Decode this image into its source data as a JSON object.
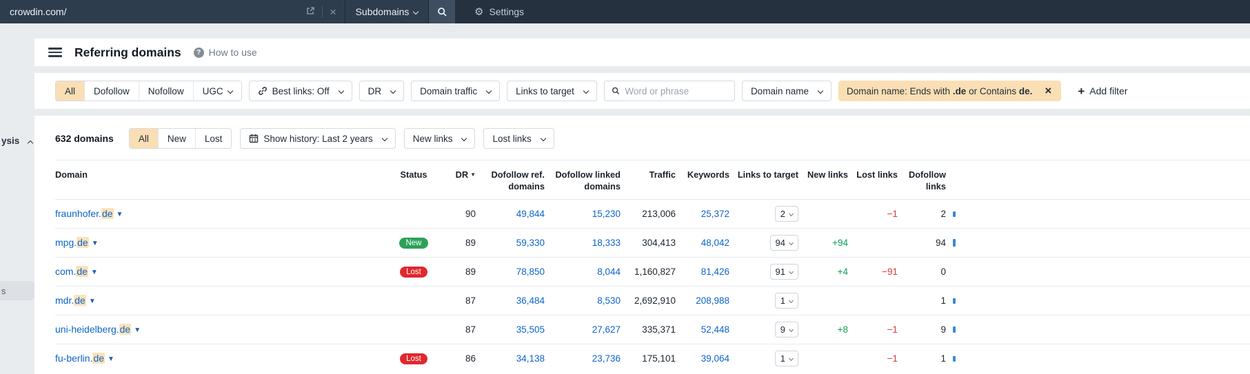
{
  "topbar": {
    "target": "crowdin.com/",
    "mode": "Subdomains",
    "settings": "Settings"
  },
  "header": {
    "title": "Referring domains",
    "help": "How to use"
  },
  "rail": {
    "partial_label": "ysis",
    "partial_letter": "s"
  },
  "filters": {
    "segments": [
      "All",
      "Dofollow",
      "Nofollow",
      "UGC"
    ],
    "selected_segment": "All",
    "best_links": "Best links: Off",
    "dr": "DR",
    "domain_traffic": "Domain traffic",
    "links_to_target": "Links to target",
    "search_placeholder": "Word or phrase",
    "domain_name": "Domain name",
    "active_filter": {
      "t1": "Domain name: Ends with ",
      "b1": ".de",
      "t2": " or Contains ",
      "b2": "de."
    },
    "add_filter": "Add filter"
  },
  "toolbar": {
    "count": "632 domains",
    "segments": [
      "All",
      "New",
      "Lost"
    ],
    "selected_segment": "All",
    "show_history": "Show history: Last 2 years",
    "new_links": "New links",
    "lost_links": "Lost links"
  },
  "table": {
    "columns": {
      "domain": "Domain",
      "status": "Status",
      "dr": "DR",
      "dofollow_ref": "Dofollow ref. domains",
      "dofollow_linked": "Dofollow linked domains",
      "traffic": "Traffic",
      "keywords": "Keywords",
      "links_to_target": "Links to target",
      "new_links": "New links",
      "lost_links": "Lost links",
      "dofollow_links": "Dofollow links"
    },
    "rows": [
      {
        "domain_prefix": "fraunhofer.",
        "match": "de",
        "status": "",
        "dr": "90",
        "dofollow_ref": "49,844",
        "dofollow_linked": "15,230",
        "traffic": "213,006",
        "keywords": "25,372",
        "links_to_target": "2",
        "new_links": "",
        "lost_links": "−1",
        "dofollow_links": "2",
        "spark_h": 8
      },
      {
        "domain_prefix": "mpg.",
        "match": "de",
        "status": "New",
        "dr": "89",
        "dofollow_ref": "59,330",
        "dofollow_linked": "18,333",
        "traffic": "304,413",
        "keywords": "48,042",
        "links_to_target": "94",
        "new_links": "+94",
        "lost_links": "",
        "dofollow_links": "94",
        "spark_h": 11
      },
      {
        "domain_prefix": "com.",
        "match": "de",
        "status": "Lost",
        "dr": "89",
        "dofollow_ref": "78,850",
        "dofollow_linked": "8,044",
        "traffic": "1,160,827",
        "keywords": "81,426",
        "links_to_target": "91",
        "new_links": "+4",
        "lost_links": "−91",
        "dofollow_links": "0",
        "spark_h": 0
      },
      {
        "domain_prefix": "mdr.",
        "match": "de",
        "status": "",
        "dr": "87",
        "dofollow_ref": "36,484",
        "dofollow_linked": "8,530",
        "traffic": "2,692,910",
        "keywords": "208,988",
        "links_to_target": "1",
        "new_links": "",
        "lost_links": "",
        "dofollow_links": "1",
        "spark_h": 8
      },
      {
        "domain_prefix": "uni-heidelberg.",
        "match": "de",
        "status": "",
        "dr": "87",
        "dofollow_ref": "35,505",
        "dofollow_linked": "27,627",
        "traffic": "335,371",
        "keywords": "52,448",
        "links_to_target": "9",
        "new_links": "+8",
        "lost_links": "−1",
        "dofollow_links": "9",
        "spark_h": 9
      },
      {
        "domain_prefix": "fu-berlin.",
        "match": "de",
        "status": "Lost",
        "dr": "86",
        "dofollow_ref": "34,138",
        "dofollow_linked": "23,736",
        "traffic": "175,101",
        "keywords": "39,064",
        "links_to_target": "1",
        "new_links": "",
        "lost_links": "−1",
        "dofollow_links": "1",
        "spark_h": 8
      }
    ]
  },
  "colors": {
    "accent_peach": "#fadfb5",
    "link_blue": "#0c64cb",
    "positive_green": "#0f9f56",
    "negative_red": "#d63a3a",
    "badge_new": "#2aa158",
    "badge_lost": "#e0282e"
  }
}
